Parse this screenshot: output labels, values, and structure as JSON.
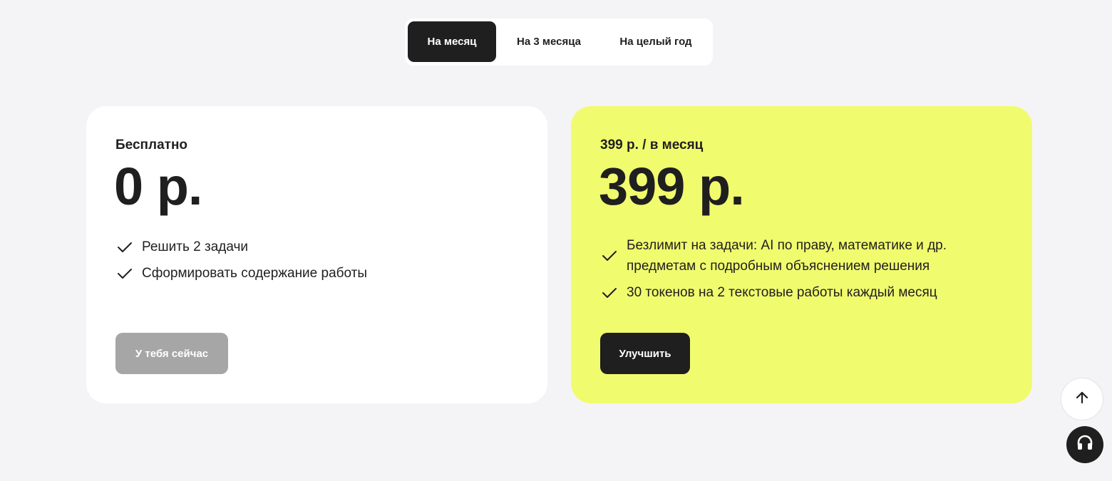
{
  "tabs": [
    {
      "label": "На месяц",
      "active": true
    },
    {
      "label": "На 3 месяца",
      "active": false
    },
    {
      "label": "На целый год",
      "active": false
    }
  ],
  "plans": {
    "free": {
      "name": "Бесплатно",
      "price": "0 р.",
      "features": [
        "Решить 2 задачи",
        "Сформировать содержание работы"
      ],
      "button_label": "У тебя сейчас"
    },
    "pro": {
      "name": "399 р. / в месяц",
      "price": "399 р.",
      "features": [
        "Безлимит на задачи: AI по праву, математике и др. предметам с подробным объяснением решения",
        "30 токенов на 2 текстовые работы каждый месяц"
      ],
      "button_label": "Улучшить"
    }
  },
  "colors": {
    "background": "#f4f4f6",
    "pro_card": "#f1fb6e",
    "dark": "#1f1f1f",
    "disabled_button": "#a6a6a6"
  },
  "icons": {
    "feature": "check-icon",
    "scroll_top": "arrow-up-icon",
    "support": "headset-icon"
  }
}
